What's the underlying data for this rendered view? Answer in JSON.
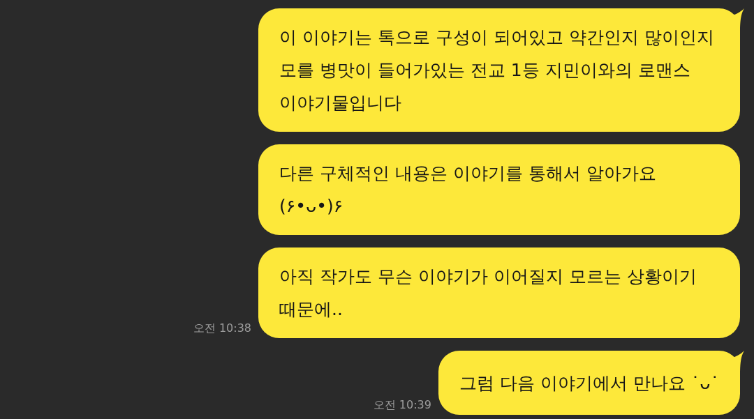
{
  "messages": [
    {
      "text": "이 이야기는 톡으로 구성이 되어있고 약간인지 많이인지 모를 병맛이 들어가있는 전교 1등 지민이와의 로맨스 이야기물입니다",
      "tail": true
    },
    {
      "text": "다른 구체적인 내용은 이야기를 통해서 알아가요 (۶•ᴗ•)۶",
      "tail": false
    },
    {
      "text": "아직 작가도 무슨 이야기가 이어질지 모르는 상황이기 때문에..",
      "tail": false,
      "time": "오전 10:38"
    },
    {
      "text": "그럼 다음 이야기에서 만나요 ˙ᴗ˙",
      "tail": true,
      "time": "오전 10:39"
    }
  ]
}
